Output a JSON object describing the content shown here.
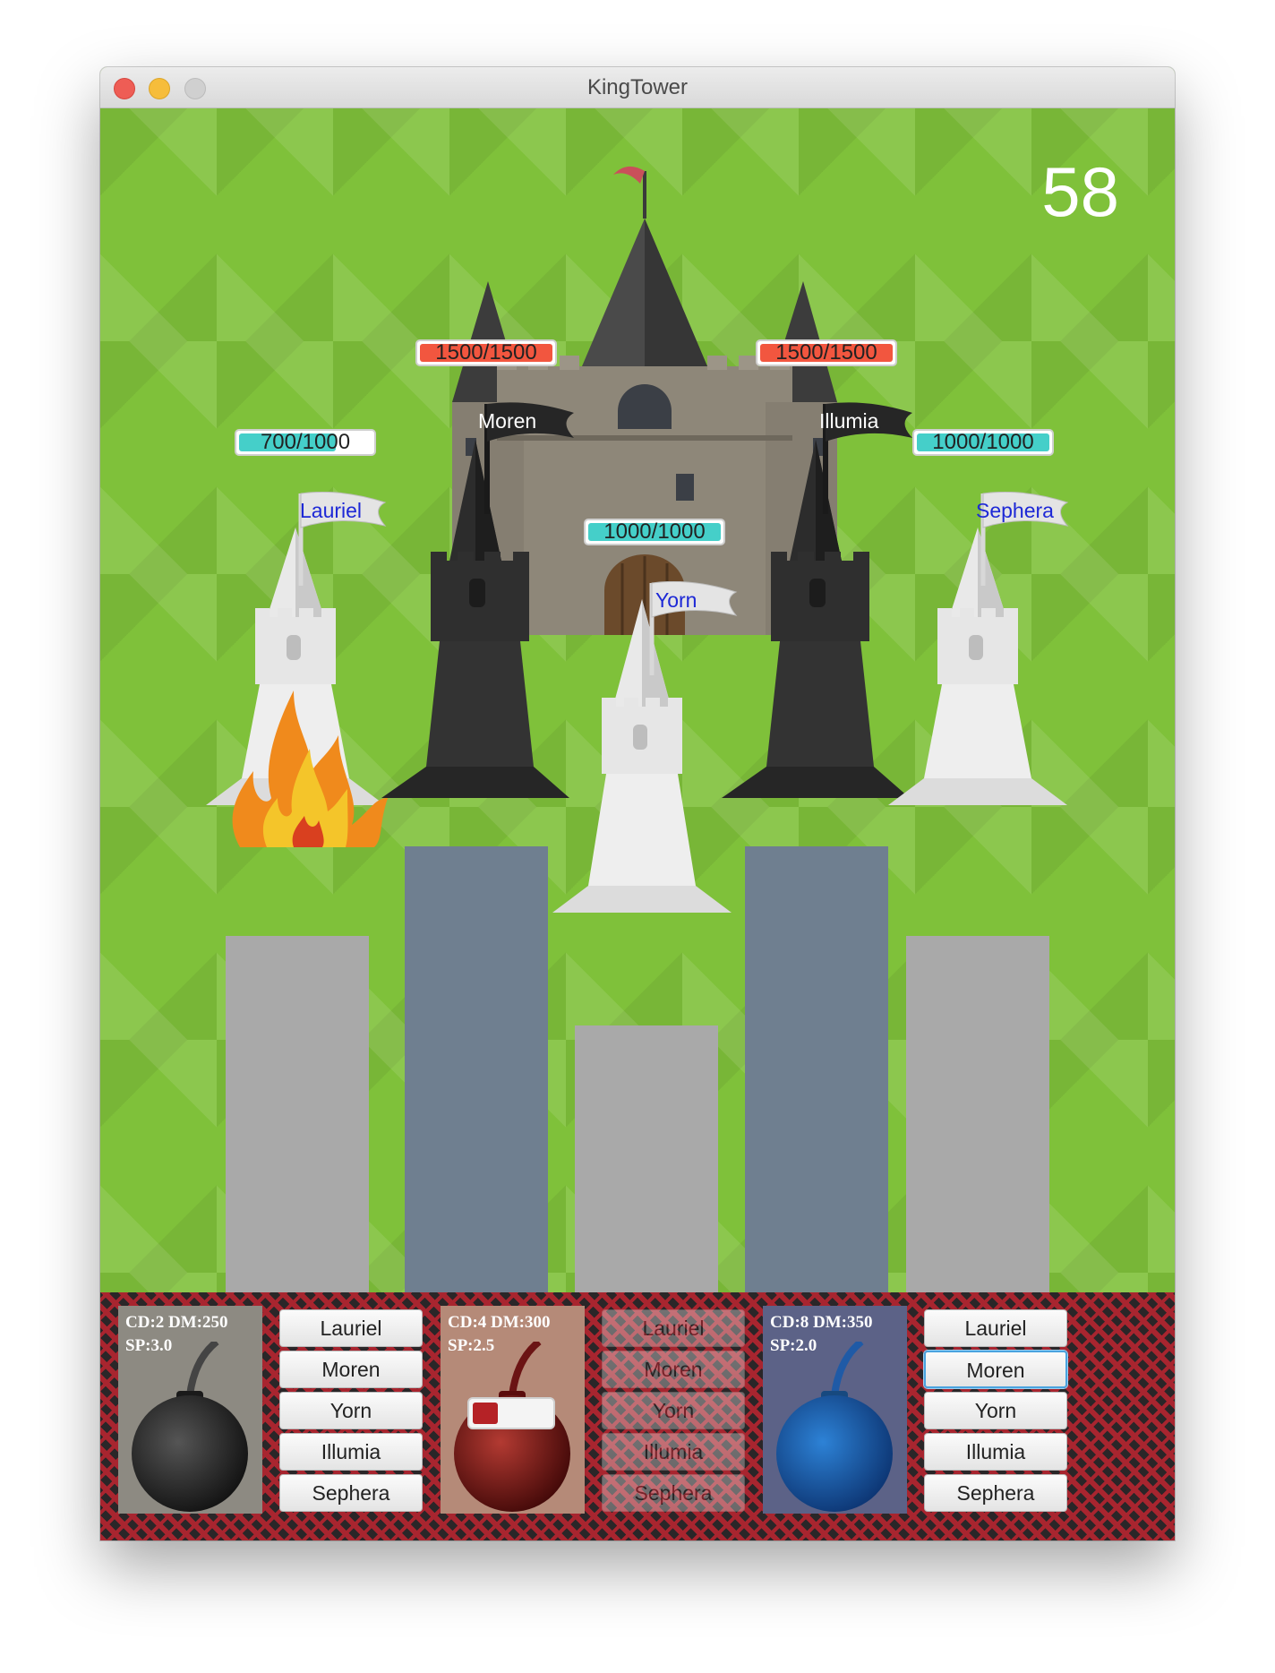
{
  "window": {
    "title": "KingTower"
  },
  "timer": "58",
  "colors": {
    "hp_player": "#45cfc9",
    "hp_enemy": "#f2563f",
    "pillar_player": "#a9a9a9",
    "pillar_enemy": "#6f7f90"
  },
  "towers": [
    {
      "name": "Lauriel",
      "hp": "700/1000",
      "hp_fraction": 0.7,
      "side": "white",
      "on_fire": true
    },
    {
      "name": "Moren",
      "hp": "1500/1500",
      "hp_fraction": 1.0,
      "side": "black",
      "on_fire": false
    },
    {
      "name": "Yorn",
      "hp": "1000/1000",
      "hp_fraction": 1.0,
      "side": "white",
      "on_fire": false
    },
    {
      "name": "Illumia",
      "hp": "1500/1500",
      "hp_fraction": 1.0,
      "side": "black",
      "on_fire": false
    },
    {
      "name": "Sephera",
      "hp": "1000/1000",
      "hp_fraction": 1.0,
      "side": "white",
      "on_fire": false
    }
  ],
  "bombs": [
    {
      "stats_line1": "CD:2 DM:250",
      "stats_line2": "SP:3.0",
      "icon": "black-bomb-icon",
      "cooldown_fraction": null,
      "targets": [
        "Lauriel",
        "Moren",
        "Yorn",
        "Illumia",
        "Sephera"
      ],
      "enabled": true,
      "focused_target": null
    },
    {
      "stats_line1": "CD:4 DM:300",
      "stats_line2": "SP:2.5",
      "icon": "red-bomb-icon",
      "cooldown_fraction": 0.3,
      "targets": [
        "Lauriel",
        "Moren",
        "Yorn",
        "Illumia",
        "Sephera"
      ],
      "enabled": false,
      "focused_target": null
    },
    {
      "stats_line1": "CD:8 DM:350",
      "stats_line2": "SP:2.0",
      "icon": "blue-bomb-icon",
      "cooldown_fraction": null,
      "targets": [
        "Lauriel",
        "Moren",
        "Yorn",
        "Illumia",
        "Sephera"
      ],
      "enabled": true,
      "focused_target": "Moren"
    }
  ]
}
